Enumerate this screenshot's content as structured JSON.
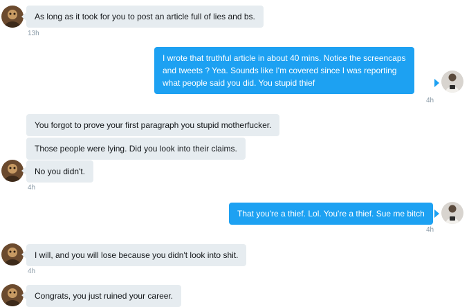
{
  "conversation": {
    "messages": [
      {
        "id": 1,
        "direction": "incoming",
        "lines": [
          "As long as it took for you to post an article full of lies and bs."
        ],
        "time": "13h"
      },
      {
        "id": 2,
        "direction": "outgoing",
        "lines": [
          "I wrote that truthful article in about 40 mins.   Notice the screencaps",
          "and tweets ?  Yea. Sounds like I'm covered since I was reporting",
          "what people said you did.  You stupid thief"
        ],
        "time": "4h"
      },
      {
        "id": 3,
        "direction": "incoming",
        "lines": [
          "You forgot to prove your first paragraph you stupid motherfucker."
        ]
      },
      {
        "id": 4,
        "direction": "incoming",
        "lines": [
          "Those people were lying. Did you look into their claims."
        ]
      },
      {
        "id": 5,
        "direction": "incoming",
        "lines": [
          "No you didn't."
        ],
        "time": "4h"
      },
      {
        "id": 6,
        "direction": "outgoing",
        "lines": [
          "That you're a thief.  Lol. You're a thief. Sue me bitch"
        ],
        "time": "4h"
      },
      {
        "id": 7,
        "direction": "incoming",
        "lines": [
          "I will, and you will lose because you didn't look into shit."
        ],
        "time": "4h"
      },
      {
        "id": 8,
        "direction": "incoming",
        "lines": [
          "Congrats, you just ruined your career."
        ]
      }
    ]
  },
  "colors": {
    "incoming_bubble": "#e6ecf0",
    "outgoing_bubble": "#1da1f2",
    "timestamp": "#8899a6"
  },
  "icons": {
    "other_avatar": "user-avatar-icon",
    "self_avatar": "user-avatar-icon"
  }
}
